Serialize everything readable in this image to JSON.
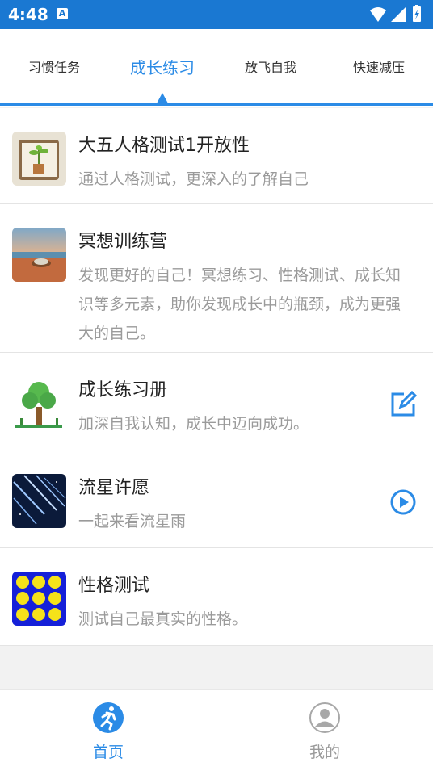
{
  "status_bar": {
    "time": "4:48",
    "notification_icon_letter": "A"
  },
  "tabs": [
    {
      "label": "习惯任务",
      "active": false
    },
    {
      "label": "成长练习",
      "active": true
    },
    {
      "label": "放飞自我",
      "active": false
    },
    {
      "label": "快速减压",
      "active": false
    }
  ],
  "list": [
    {
      "title": "大五人格测试1开放性",
      "desc": "通过人格测试，更深入的了解自己",
      "thumb": "notebook-plant-image",
      "action": ""
    },
    {
      "title": "冥想训练营",
      "desc": "发现更好的自己！冥想练习、性格测试、成长知识等多元素，助你发现成长中的瓶颈，成为更强大的自己。",
      "thumb": "beach-sunset-image",
      "action": ""
    },
    {
      "title": "成长练习册",
      "desc": "加深自我认知，成长中迈向成功。",
      "thumb": "tree-image",
      "action": "edit-icon"
    },
    {
      "title": "流星许愿",
      "desc": "一起来看流星雨",
      "thumb": "meteor-shower-image",
      "action": "play-icon"
    },
    {
      "title": "性格测试",
      "desc": "测试自己最真实的性格。",
      "thumb": "emoji-faces-image",
      "action": ""
    }
  ],
  "bottom_nav": [
    {
      "label": "首页",
      "icon": "runner-icon",
      "active": true
    },
    {
      "label": "我的",
      "icon": "profile-icon",
      "active": false
    }
  ],
  "colors": {
    "accent": "#2b8be6",
    "status_bar": "#1a78d2",
    "inactive": "#9a9a9a"
  }
}
